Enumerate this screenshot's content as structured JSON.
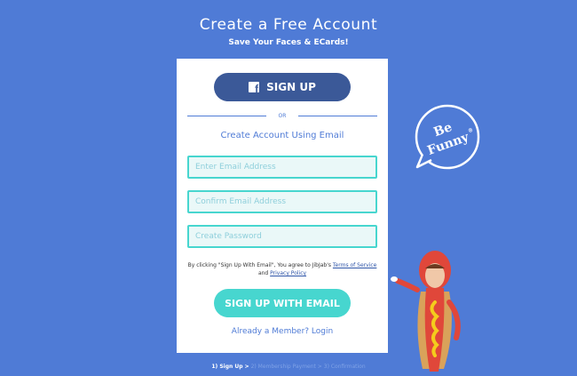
{
  "header": {
    "title": "Create a Free Account",
    "subtitle": "Save Your Faces & ECards!"
  },
  "card": {
    "facebook_button_label": "SIGN UP",
    "facebook_icon_glyph": "f",
    "or_label": "OR",
    "create_email_label": "Create Account Using Email",
    "fields": {
      "email_placeholder": "Enter Email Address",
      "confirm_email_placeholder": "Confirm Email Address",
      "password_placeholder": "Create Password"
    },
    "terms": {
      "prefix": "By clicking \"Sign Up With Email\", You agree to JibJab's",
      "terms_link": "Terms of Service",
      "conjunction": "and",
      "privacy_link": "Privacy Policy"
    },
    "email_button_label": "SIGN UP WITH EMAIL",
    "login_link": "Already a Member? Login"
  },
  "steps": {
    "step1": "1) Sign Up >",
    "step2": "2) Membership Payment >",
    "step3": "3) Confirmation"
  },
  "badge": {
    "line1": "Be",
    "line2": "Funny",
    "mark": "®"
  },
  "colors": {
    "background": "#4f7bd6",
    "facebook": "#3b5998",
    "accent_teal": "#47d6cf"
  }
}
